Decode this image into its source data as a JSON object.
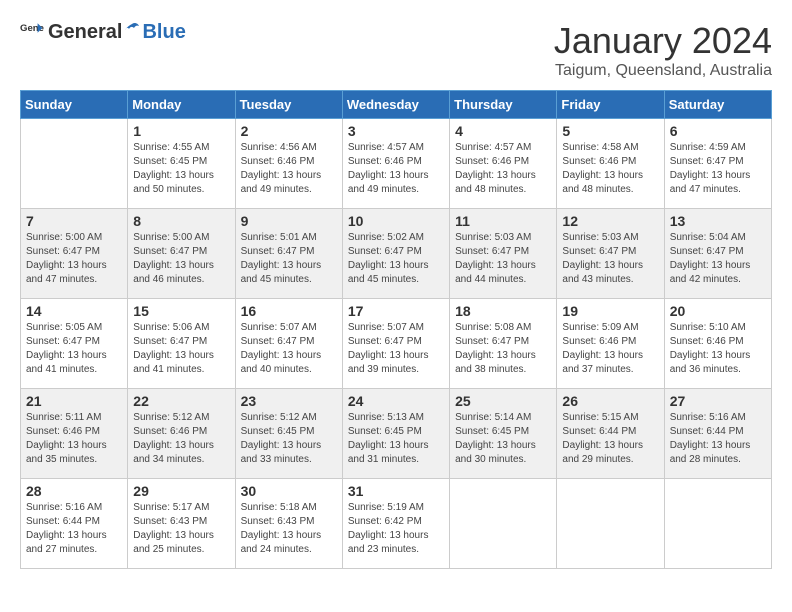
{
  "header": {
    "logo_general": "General",
    "logo_blue": "Blue",
    "month": "January 2024",
    "location": "Taigum, Queensland, Australia"
  },
  "weekdays": [
    "Sunday",
    "Monday",
    "Tuesday",
    "Wednesday",
    "Thursday",
    "Friday",
    "Saturday"
  ],
  "weeks": [
    [
      {
        "day": "",
        "sunrise": "",
        "sunset": "",
        "daylight": ""
      },
      {
        "day": "1",
        "sunrise": "Sunrise: 4:55 AM",
        "sunset": "Sunset: 6:45 PM",
        "daylight": "Daylight: 13 hours and 50 minutes."
      },
      {
        "day": "2",
        "sunrise": "Sunrise: 4:56 AM",
        "sunset": "Sunset: 6:46 PM",
        "daylight": "Daylight: 13 hours and 49 minutes."
      },
      {
        "day": "3",
        "sunrise": "Sunrise: 4:57 AM",
        "sunset": "Sunset: 6:46 PM",
        "daylight": "Daylight: 13 hours and 49 minutes."
      },
      {
        "day": "4",
        "sunrise": "Sunrise: 4:57 AM",
        "sunset": "Sunset: 6:46 PM",
        "daylight": "Daylight: 13 hours and 48 minutes."
      },
      {
        "day": "5",
        "sunrise": "Sunrise: 4:58 AM",
        "sunset": "Sunset: 6:46 PM",
        "daylight": "Daylight: 13 hours and 48 minutes."
      },
      {
        "day": "6",
        "sunrise": "Sunrise: 4:59 AM",
        "sunset": "Sunset: 6:47 PM",
        "daylight": "Daylight: 13 hours and 47 minutes."
      }
    ],
    [
      {
        "day": "7",
        "sunrise": "Sunrise: 5:00 AM",
        "sunset": "Sunset: 6:47 PM",
        "daylight": "Daylight: 13 hours and 47 minutes."
      },
      {
        "day": "8",
        "sunrise": "Sunrise: 5:00 AM",
        "sunset": "Sunset: 6:47 PM",
        "daylight": "Daylight: 13 hours and 46 minutes."
      },
      {
        "day": "9",
        "sunrise": "Sunrise: 5:01 AM",
        "sunset": "Sunset: 6:47 PM",
        "daylight": "Daylight: 13 hours and 45 minutes."
      },
      {
        "day": "10",
        "sunrise": "Sunrise: 5:02 AM",
        "sunset": "Sunset: 6:47 PM",
        "daylight": "Daylight: 13 hours and 45 minutes."
      },
      {
        "day": "11",
        "sunrise": "Sunrise: 5:03 AM",
        "sunset": "Sunset: 6:47 PM",
        "daylight": "Daylight: 13 hours and 44 minutes."
      },
      {
        "day": "12",
        "sunrise": "Sunrise: 5:03 AM",
        "sunset": "Sunset: 6:47 PM",
        "daylight": "Daylight: 13 hours and 43 minutes."
      },
      {
        "day": "13",
        "sunrise": "Sunrise: 5:04 AM",
        "sunset": "Sunset: 6:47 PM",
        "daylight": "Daylight: 13 hours and 42 minutes."
      }
    ],
    [
      {
        "day": "14",
        "sunrise": "Sunrise: 5:05 AM",
        "sunset": "Sunset: 6:47 PM",
        "daylight": "Daylight: 13 hours and 41 minutes."
      },
      {
        "day": "15",
        "sunrise": "Sunrise: 5:06 AM",
        "sunset": "Sunset: 6:47 PM",
        "daylight": "Daylight: 13 hours and 41 minutes."
      },
      {
        "day": "16",
        "sunrise": "Sunrise: 5:07 AM",
        "sunset": "Sunset: 6:47 PM",
        "daylight": "Daylight: 13 hours and 40 minutes."
      },
      {
        "day": "17",
        "sunrise": "Sunrise: 5:07 AM",
        "sunset": "Sunset: 6:47 PM",
        "daylight": "Daylight: 13 hours and 39 minutes."
      },
      {
        "day": "18",
        "sunrise": "Sunrise: 5:08 AM",
        "sunset": "Sunset: 6:47 PM",
        "daylight": "Daylight: 13 hours and 38 minutes."
      },
      {
        "day": "19",
        "sunrise": "Sunrise: 5:09 AM",
        "sunset": "Sunset: 6:46 PM",
        "daylight": "Daylight: 13 hours and 37 minutes."
      },
      {
        "day": "20",
        "sunrise": "Sunrise: 5:10 AM",
        "sunset": "Sunset: 6:46 PM",
        "daylight": "Daylight: 13 hours and 36 minutes."
      }
    ],
    [
      {
        "day": "21",
        "sunrise": "Sunrise: 5:11 AM",
        "sunset": "Sunset: 6:46 PM",
        "daylight": "Daylight: 13 hours and 35 minutes."
      },
      {
        "day": "22",
        "sunrise": "Sunrise: 5:12 AM",
        "sunset": "Sunset: 6:46 PM",
        "daylight": "Daylight: 13 hours and 34 minutes."
      },
      {
        "day": "23",
        "sunrise": "Sunrise: 5:12 AM",
        "sunset": "Sunset: 6:45 PM",
        "daylight": "Daylight: 13 hours and 33 minutes."
      },
      {
        "day": "24",
        "sunrise": "Sunrise: 5:13 AM",
        "sunset": "Sunset: 6:45 PM",
        "daylight": "Daylight: 13 hours and 31 minutes."
      },
      {
        "day": "25",
        "sunrise": "Sunrise: 5:14 AM",
        "sunset": "Sunset: 6:45 PM",
        "daylight": "Daylight: 13 hours and 30 minutes."
      },
      {
        "day": "26",
        "sunrise": "Sunrise: 5:15 AM",
        "sunset": "Sunset: 6:44 PM",
        "daylight": "Daylight: 13 hours and 29 minutes."
      },
      {
        "day": "27",
        "sunrise": "Sunrise: 5:16 AM",
        "sunset": "Sunset: 6:44 PM",
        "daylight": "Daylight: 13 hours and 28 minutes."
      }
    ],
    [
      {
        "day": "28",
        "sunrise": "Sunrise: 5:16 AM",
        "sunset": "Sunset: 6:44 PM",
        "daylight": "Daylight: 13 hours and 27 minutes."
      },
      {
        "day": "29",
        "sunrise": "Sunrise: 5:17 AM",
        "sunset": "Sunset: 6:43 PM",
        "daylight": "Daylight: 13 hours and 25 minutes."
      },
      {
        "day": "30",
        "sunrise": "Sunrise: 5:18 AM",
        "sunset": "Sunset: 6:43 PM",
        "daylight": "Daylight: 13 hours and 24 minutes."
      },
      {
        "day": "31",
        "sunrise": "Sunrise: 5:19 AM",
        "sunset": "Sunset: 6:42 PM",
        "daylight": "Daylight: 13 hours and 23 minutes."
      },
      {
        "day": "",
        "sunrise": "",
        "sunset": "",
        "daylight": ""
      },
      {
        "day": "",
        "sunrise": "",
        "sunset": "",
        "daylight": ""
      },
      {
        "day": "",
        "sunrise": "",
        "sunset": "",
        "daylight": ""
      }
    ]
  ]
}
